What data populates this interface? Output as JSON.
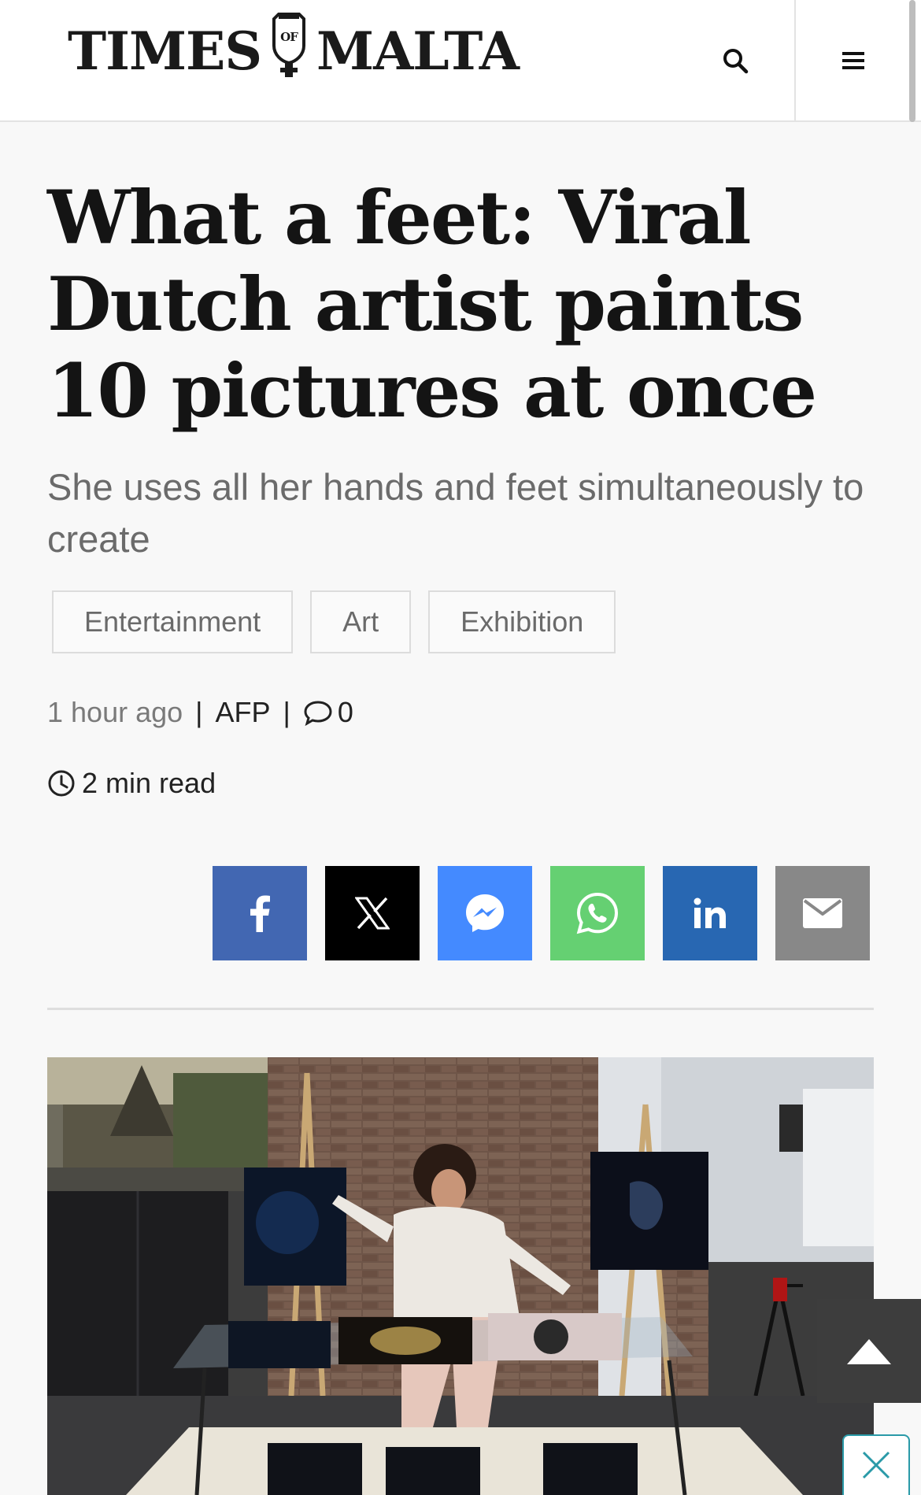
{
  "header": {
    "logo_left": "TIMES",
    "logo_crest": "OF",
    "logo_right": "MALTA",
    "search_icon": "search-icon",
    "menu_icon": "hamburger-menu-icon"
  },
  "article": {
    "headline": "What a feet: Viral Dutch artist paints 10 pictures at once",
    "subheadline": "She uses all her hands and feet simultaneously to create",
    "tags": [
      "Entertainment",
      "Art",
      "Exhibition"
    ],
    "meta": {
      "time_ago": "1 hour ago",
      "author": "AFP",
      "comment_count": "0"
    },
    "read_time": "2 min read"
  },
  "share": {
    "buttons": [
      {
        "name": "facebook",
        "icon": "facebook-icon",
        "color": "#4267b2"
      },
      {
        "name": "x",
        "icon": "x-icon",
        "color": "#000000"
      },
      {
        "name": "messenger",
        "icon": "messenger-icon",
        "color": "#448aff"
      },
      {
        "name": "whatsapp",
        "icon": "whatsapp-icon",
        "color": "#65d072"
      },
      {
        "name": "linkedin",
        "icon": "linkedin-icon",
        "color": "#2867b2"
      },
      {
        "name": "email",
        "icon": "email-icon",
        "color": "#888888"
      }
    ]
  },
  "overlays": {
    "back_to_top_icon": "arrow-up-icon",
    "close_ad_icon": "close-icon"
  }
}
